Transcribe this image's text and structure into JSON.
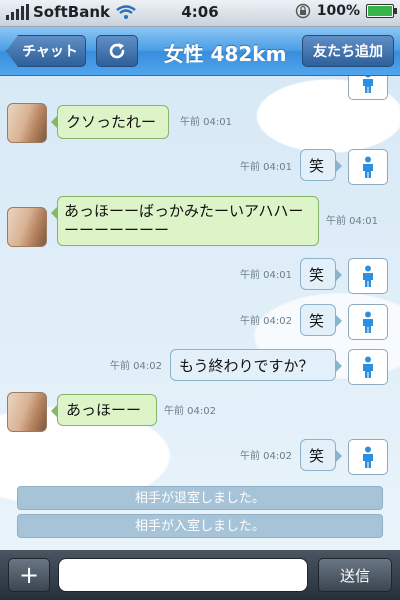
{
  "status_bar": {
    "carrier": "SoftBank",
    "time": "4:06",
    "battery": "100%",
    "signal_bars": 5
  },
  "nav": {
    "back_label": "チャット",
    "title": "女性 482km",
    "add_friend_label": "友たち追加"
  },
  "messages": [
    {
      "side": "in",
      "text": "クソったれー",
      "time": "午前 04:01"
    },
    {
      "side": "out",
      "text": "笑",
      "time": "午前 04:01"
    },
    {
      "side": "in",
      "text": "あっほーーばっかみたーいアハハーーーーーーーー",
      "time": "午前 04:01"
    },
    {
      "side": "out",
      "text": "笑",
      "time": "午前 04:01"
    },
    {
      "side": "out",
      "text": "笑",
      "time": "午前 04:02"
    },
    {
      "side": "out",
      "text": "もう終わりですか？",
      "time": "午前 04:02"
    },
    {
      "side": "in",
      "text": "あっほーー",
      "time": "午前 04:02"
    },
    {
      "side": "out",
      "text": "笑",
      "time": "午前 04:02"
    }
  ],
  "system_messages": [
    "相手が退室しました。",
    "相手が入室しました。"
  ],
  "input": {
    "plus_label": "+",
    "placeholder": "",
    "send_label": "送信"
  },
  "colors": {
    "nav_blue": "#4b9fe6",
    "incoming_bubble": "#dcf4c8",
    "outgoing_bubble": "#e3f0fa",
    "system_bar": "#a6c3d8"
  }
}
